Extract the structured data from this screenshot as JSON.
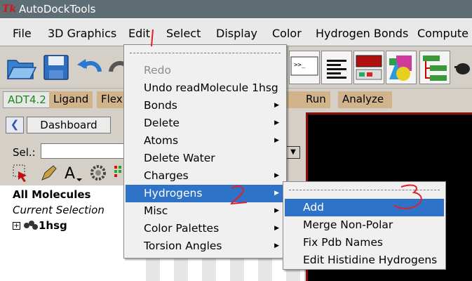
{
  "window": {
    "title": "AutoDockTools",
    "logo": "Tk"
  },
  "menubar": {
    "items": [
      "File",
      "3D Graphics",
      "Edit",
      "Select",
      "Display",
      "Color",
      "Hydrogen Bonds",
      "Compute"
    ]
  },
  "toolbar": {
    "icons": [
      "open-folder-icon",
      "save-icon",
      "undo-arrow-icon",
      "redo-arrow-icon",
      "terminal-icon",
      "text-align-icon",
      "panel-icon",
      "shapes-icon",
      "tree-icon",
      "glasses-icon"
    ]
  },
  "tabs": {
    "items": [
      "ADT4.2",
      "Ligand",
      "Flex",
      "Run",
      "Analyze"
    ]
  },
  "left_panel": {
    "dashboard_label": "Dashboard",
    "sel_label": "Sel.:",
    "sel_value": "",
    "tools": [
      "select-hand-icon",
      "pencil-icon",
      "font-a-icon",
      "gear-icon",
      "color-bars-icon"
    ],
    "tree": {
      "all_molecules": "All Molecules",
      "current_selection": "Current Selection",
      "expander": "+",
      "molecule": "1hsg"
    }
  },
  "edit_menu": {
    "items": [
      {
        "label": "Redo",
        "disabled": true,
        "submenu": false
      },
      {
        "label": "Undo readMolecule 1hsg",
        "disabled": false,
        "submenu": false
      },
      {
        "label": "Bonds",
        "disabled": false,
        "submenu": true
      },
      {
        "label": "Delete",
        "disabled": false,
        "submenu": true
      },
      {
        "label": "Atoms",
        "disabled": false,
        "submenu": true
      },
      {
        "label": "Delete Water",
        "disabled": false,
        "submenu": false
      },
      {
        "label": "Charges",
        "disabled": false,
        "submenu": true
      },
      {
        "label": "Hydrogens",
        "disabled": false,
        "submenu": true,
        "active": true
      },
      {
        "label": "Misc",
        "disabled": false,
        "submenu": true
      },
      {
        "label": "Color Palettes",
        "disabled": false,
        "submenu": true
      },
      {
        "label": "Torsion Angles",
        "disabled": false,
        "submenu": true
      }
    ]
  },
  "hydrogens_submenu": {
    "items": [
      {
        "label": "Add",
        "active": true
      },
      {
        "label": "Merge Non-Polar",
        "active": false
      },
      {
        "label": "Fix Pdb Names",
        "active": false
      },
      {
        "label": "Edit Histidine Hydrogens",
        "active": false
      }
    ]
  },
  "annotations": {
    "step_2": "2",
    "step_3": "3",
    "color": "#e0202a"
  },
  "colors": {
    "highlight": "#2e73c8",
    "tab_tan": "#d2b48c",
    "adt_green": "#1a8a1a",
    "titlebar": "#5e6e74"
  }
}
